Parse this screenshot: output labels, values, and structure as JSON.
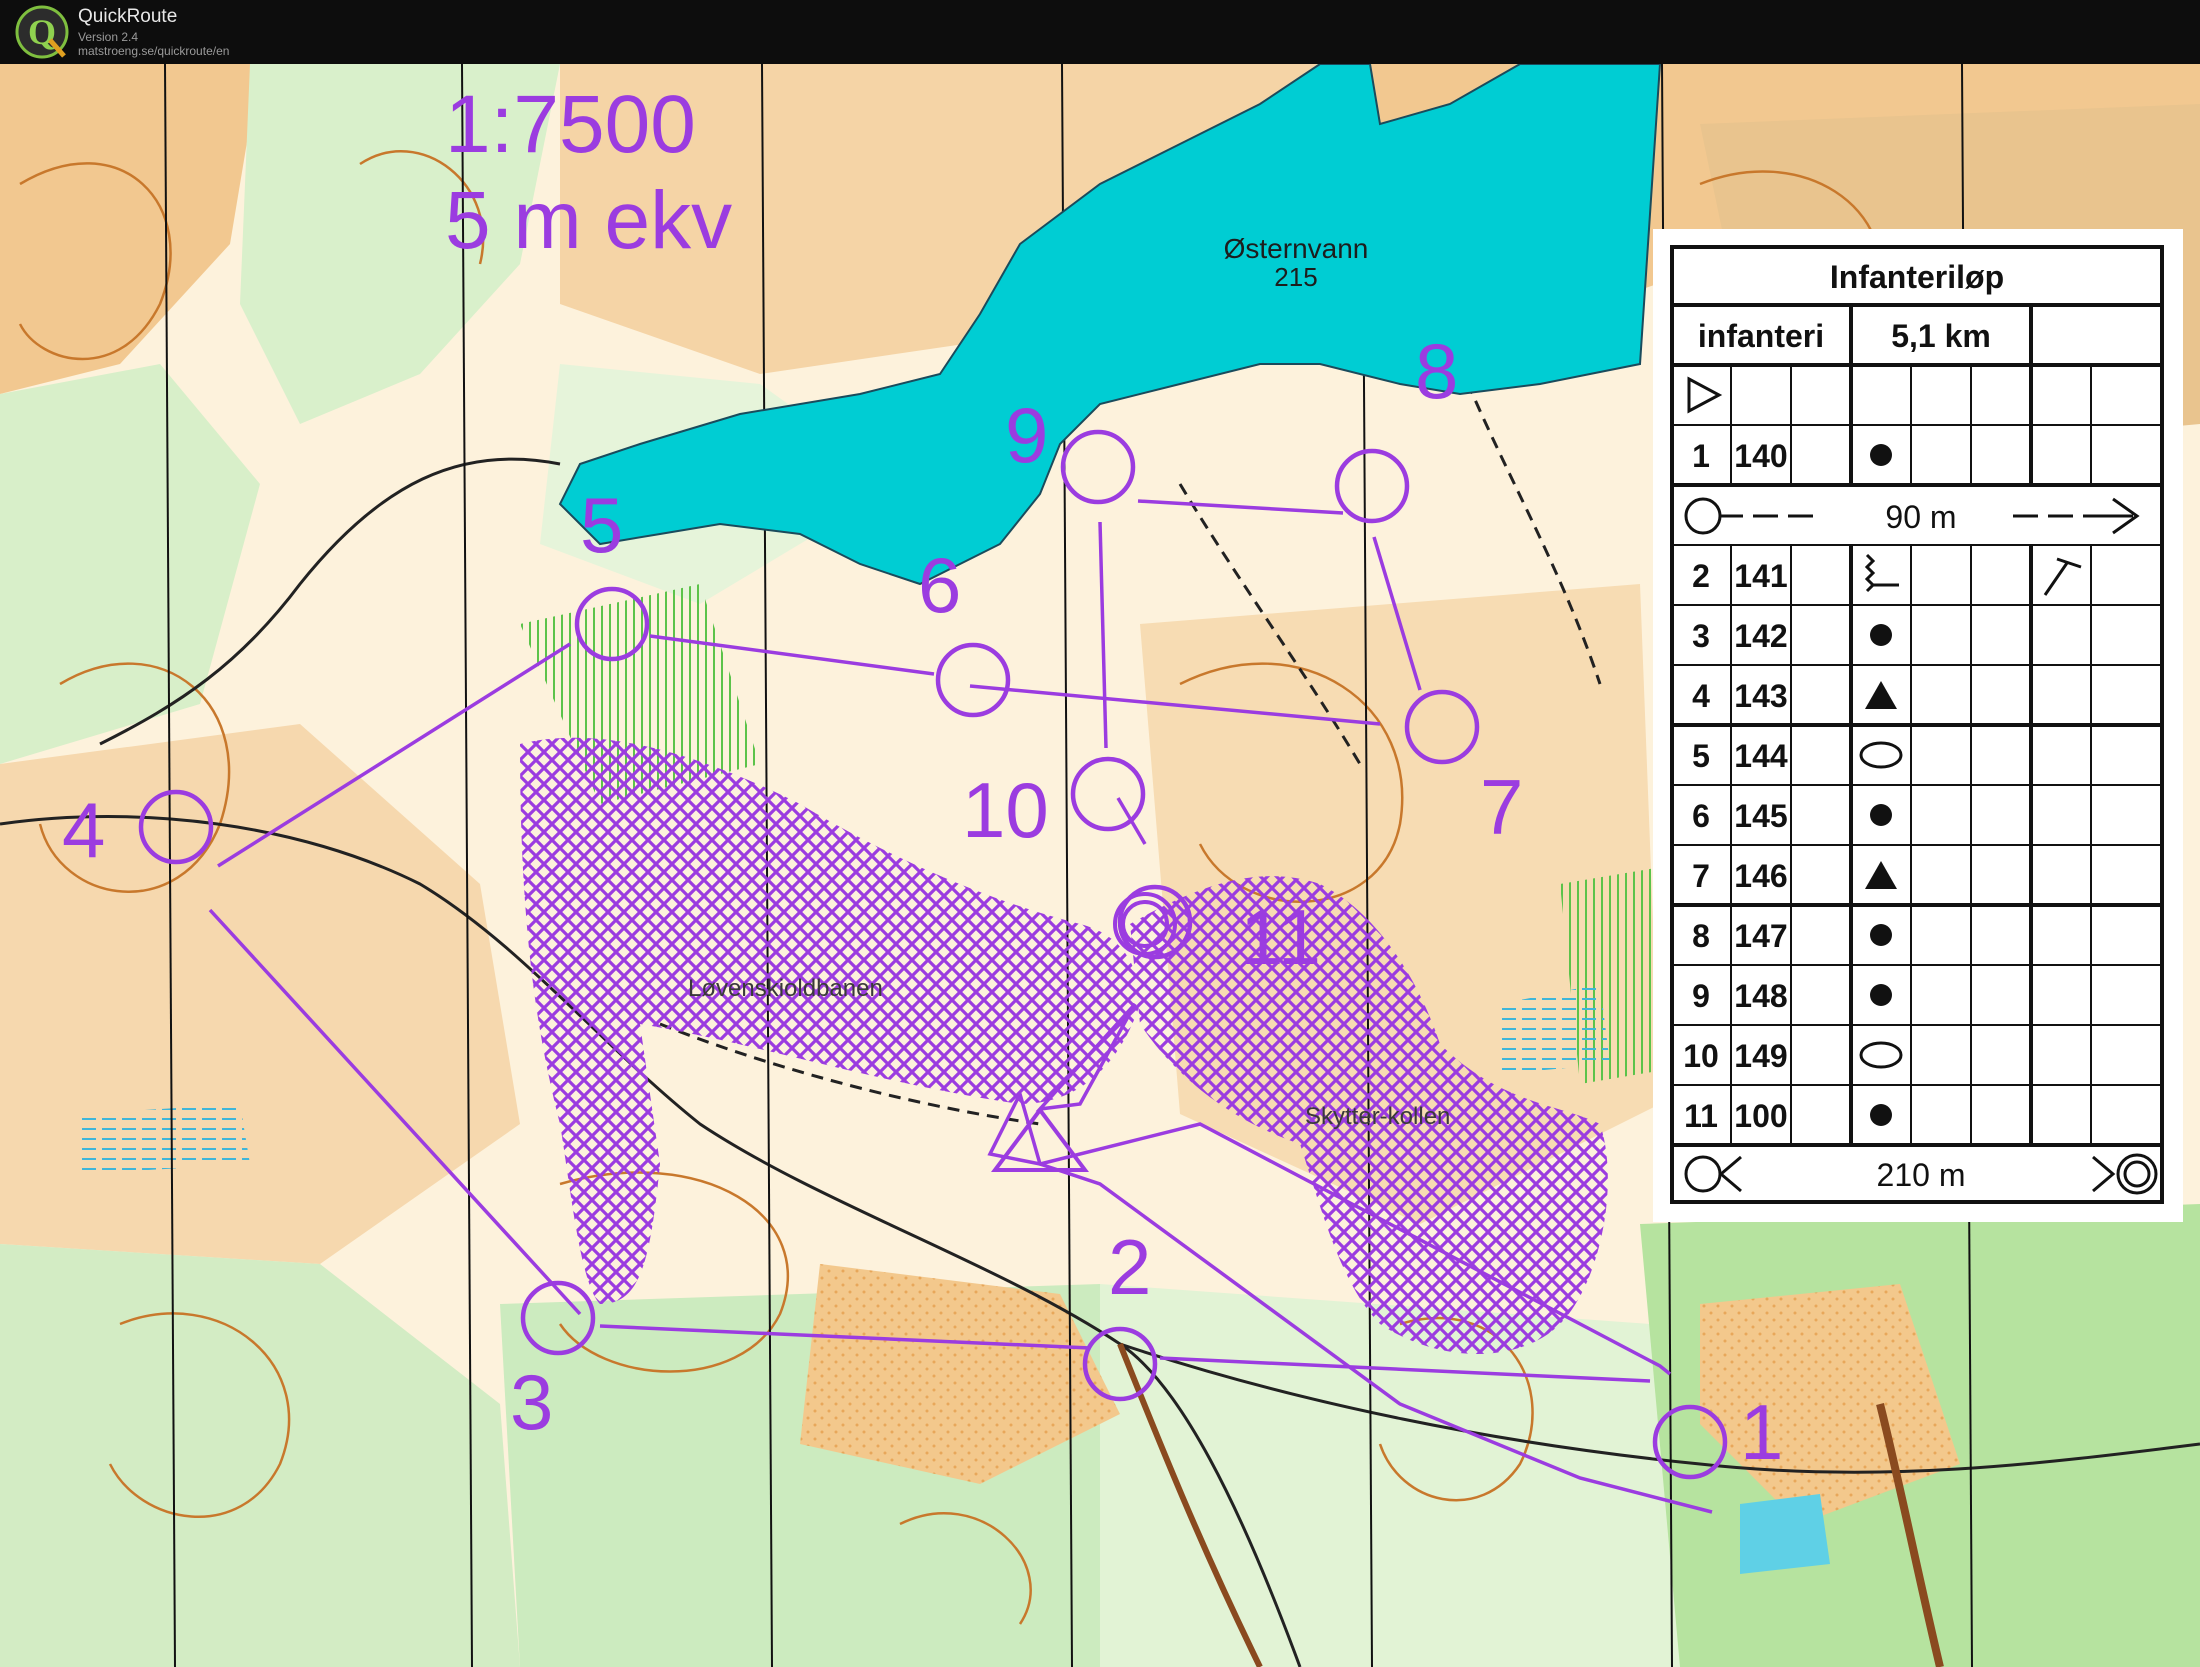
{
  "app": {
    "name": "QuickRoute",
    "version": "Version 2.4",
    "url": "matstroeng.se/quickroute/en",
    "logo_letter": "Q"
  },
  "map": {
    "scale": "1:7500",
    "contour": "5 m ekv",
    "lake_name": "Østernvann",
    "lake_height": "215",
    "place_labels": [
      "Løvenskioldbanen",
      "Skytter-kollen"
    ],
    "course_color": "#9b3ce0",
    "water_color": "#00cdd3",
    "controls": [
      {
        "number": "1"
      },
      {
        "number": "2"
      },
      {
        "number": "3"
      },
      {
        "number": "4"
      },
      {
        "number": "5"
      },
      {
        "number": "6"
      },
      {
        "number": "7"
      },
      {
        "number": "8"
      },
      {
        "number": "9"
      },
      {
        "number": "10"
      },
      {
        "number": "11"
      }
    ]
  },
  "control_descriptions": {
    "title": "Infanteriløp",
    "class": "infanteri",
    "length": "5,1 km",
    "start_symbol": "start-triangle",
    "to_first_control": "90 m",
    "to_finish": "210 m",
    "rows": [
      {
        "num": "1",
        "code": "140",
        "feature": "dot",
        "extra": ""
      },
      {
        "num": "2",
        "code": "141",
        "feature": "zigzag",
        "extra": "corner"
      },
      {
        "num": "3",
        "code": "142",
        "feature": "dot",
        "extra": ""
      },
      {
        "num": "4",
        "code": "143",
        "feature": "triangle",
        "extra": ""
      },
      {
        "num": "5",
        "code": "144",
        "feature": "ellipse",
        "extra": ""
      },
      {
        "num": "6",
        "code": "145",
        "feature": "dot",
        "extra": ""
      },
      {
        "num": "7",
        "code": "146",
        "feature": "triangle",
        "extra": ""
      },
      {
        "num": "8",
        "code": "147",
        "feature": "dot",
        "extra": ""
      },
      {
        "num": "9",
        "code": "148",
        "feature": "dot",
        "extra": ""
      },
      {
        "num": "10",
        "code": "149",
        "feature": "ellipse",
        "extra": ""
      },
      {
        "num": "11",
        "code": "100",
        "feature": "dot",
        "extra": ""
      }
    ]
  }
}
